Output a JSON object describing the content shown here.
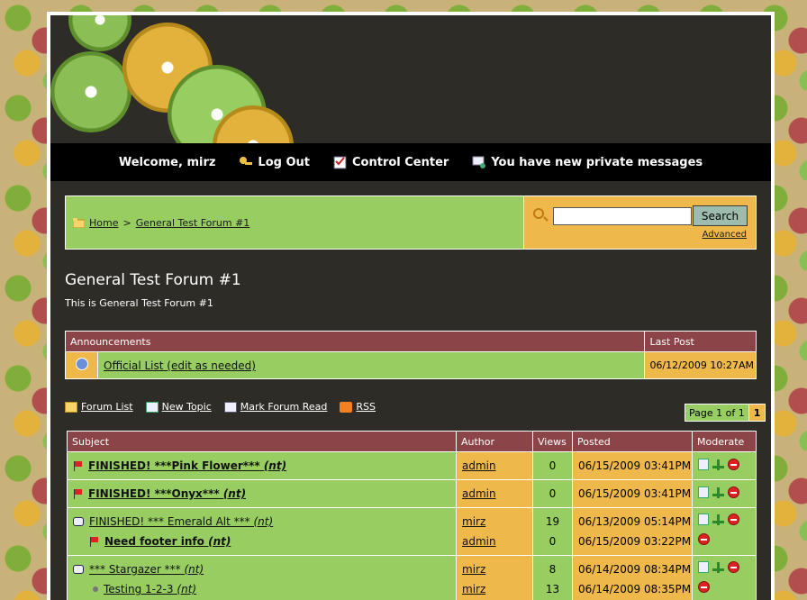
{
  "colors": {
    "green": "#97cd61",
    "orange": "#efb84a",
    "maroon": "#8b4447",
    "dark": "#2d2c27"
  },
  "nav": {
    "welcome": "Welcome, mirz",
    "logout": "Log Out",
    "control_center": "Control Center",
    "private_messages": "You have new private messages"
  },
  "breadcrumb": {
    "home": "Home",
    "separator": ">",
    "current": "General Test Forum #1"
  },
  "search": {
    "button": "Search",
    "advanced": "Advanced",
    "value": ""
  },
  "forum": {
    "title": "General Test Forum #1",
    "description": "This is General Test Forum #1"
  },
  "announcements": {
    "header_subject": "Announcements",
    "header_last": "Last Post",
    "rows": [
      {
        "title": "Official List (edit as needed)",
        "last_post": "06/12/2009 10:27AM"
      }
    ]
  },
  "toolbar": {
    "forum_list": "Forum List",
    "new_topic": "New Topic",
    "mark_read": "Mark Forum Read",
    "rss": "RSS"
  },
  "pager": {
    "label": "Page 1 of 1",
    "current": "1"
  },
  "topics": {
    "headers": {
      "subject": "Subject",
      "author": "Author",
      "views": "Views",
      "posted": "Posted",
      "moderate": "Moderate"
    },
    "rows": [
      {
        "subject": "FINISHED! ***Pink Flower***",
        "tag": "(nt)",
        "author": "admin",
        "views": "0",
        "posted": "06/15/2009 03:41PM"
      },
      {
        "subject": "FINISHED! ***Onyx***",
        "tag": "(nt)",
        "author": "admin",
        "views": "0",
        "posted": "06/15/2009 03:41PM"
      },
      {
        "subject": "FINISHED! *** Emerald Alt ***",
        "tag": "(nt)",
        "author": "mirz",
        "views": "19",
        "posted": "06/13/2009 05:14PM",
        "reply": {
          "subject": "Need footer info",
          "tag": "(nt)",
          "author": "admin",
          "views": "0",
          "posted": "06/15/2009 03:22PM"
        }
      },
      {
        "subject": "*** Stargazer ***",
        "tag": "(nt)",
        "author": "mirz",
        "views": "8",
        "posted": "06/14/2009 08:34PM",
        "reply": {
          "subject": "Testing 1-2-3",
          "tag": "(nt)",
          "author": "mirz",
          "views": "13",
          "posted": "06/14/2009 08:35PM"
        }
      }
    ]
  }
}
